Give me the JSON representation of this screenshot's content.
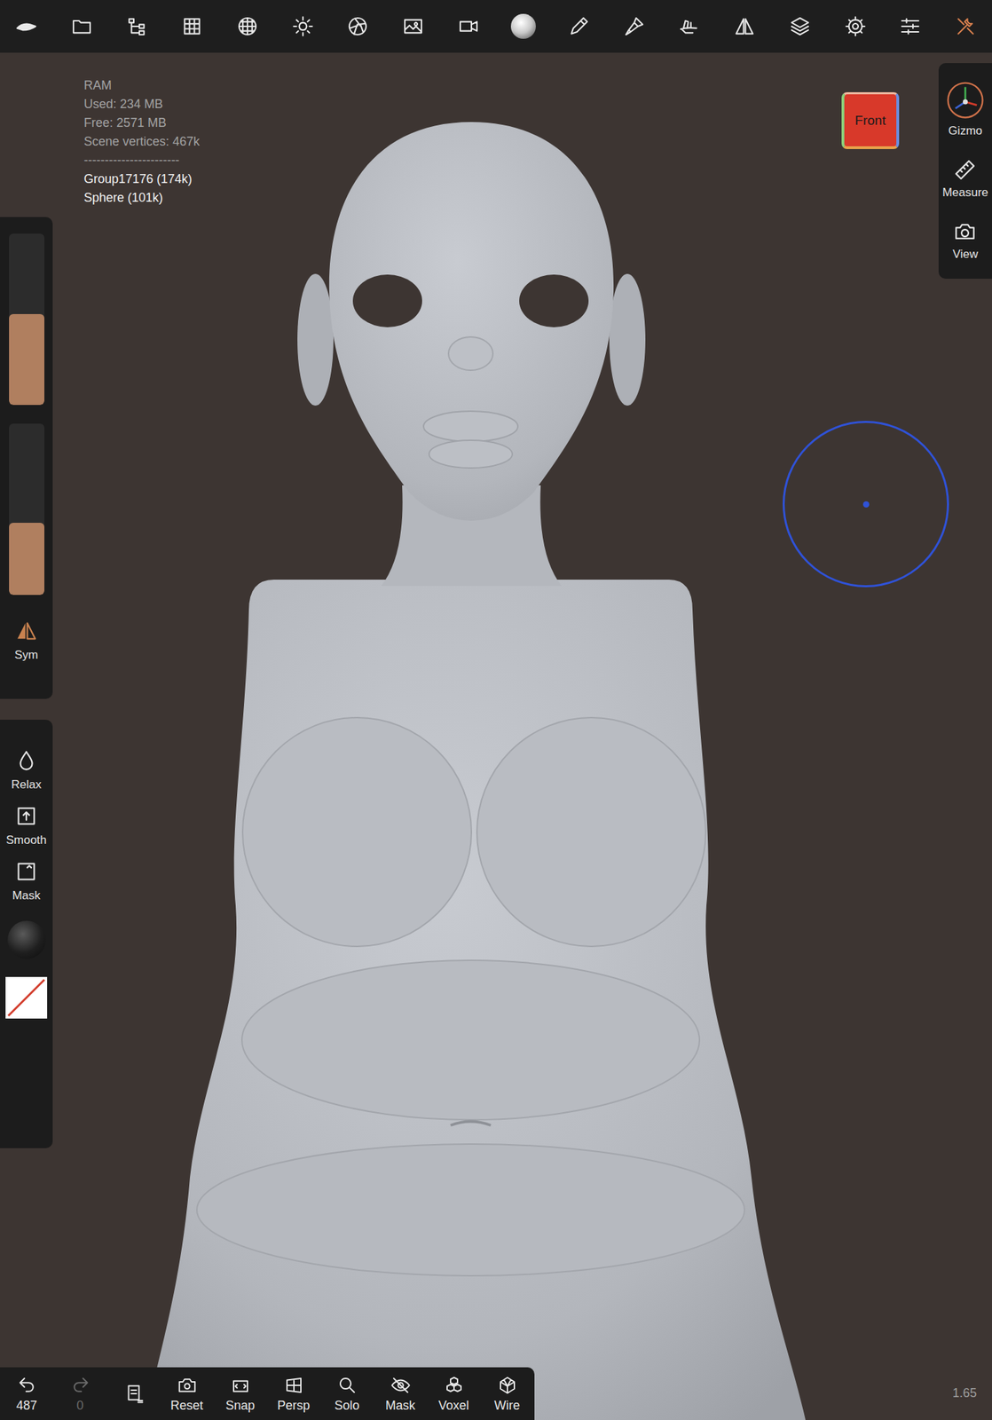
{
  "toolbar": [
    {
      "selected": false
    },
    {
      "selected": false
    },
    {
      "selected": false
    },
    {
      "selected": false
    },
    {
      "selected": false
    },
    {
      "selected": false
    },
    {
      "selected": false
    },
    {
      "selected": false
    },
    {
      "selected": false
    },
    {
      "selected": false
    },
    {
      "selected": false
    },
    {
      "selected": false
    },
    {
      "selected": false
    },
    {
      "selected": false
    },
    {
      "selected": false
    },
    {
      "selected": false
    },
    {
      "selected": false
    },
    {
      "selected": true
    }
  ],
  "stats": {
    "title": "RAM",
    "lines": [
      "Used: 234 MB",
      "Free: 2571 MB",
      "Scene vertices: 467k"
    ],
    "separator": "-----------------------"
  },
  "objects": [
    {
      "label": "Group17176 (174k)"
    },
    {
      "label": "Sphere (101k)"
    }
  ],
  "view_cube": {
    "label": "Front"
  },
  "right_panel": [
    {
      "label": "Gizmo"
    },
    {
      "label": "Measure"
    },
    {
      "label": "View"
    }
  ],
  "left_sliders": [
    {
      "level": 0.53
    },
    {
      "level": 0.42
    }
  ],
  "symmetry": {
    "label": "Sym"
  },
  "left_tools": [
    {
      "label": "Relax"
    },
    {
      "label": "Smooth"
    },
    {
      "label": "Mask"
    }
  ],
  "bottom_bar": {
    "undo": {
      "count": "487",
      "disabled": false
    },
    "redo": {
      "count": "0",
      "disabled": true
    },
    "buttons": [
      {
        "label": "Reset"
      },
      {
        "label": "Snap"
      },
      {
        "label": "Persp"
      },
      {
        "label": "Solo"
      },
      {
        "label": "Mask"
      },
      {
        "label": "Voxel"
      },
      {
        "label": "Wire"
      }
    ]
  },
  "zoom": "1.65"
}
